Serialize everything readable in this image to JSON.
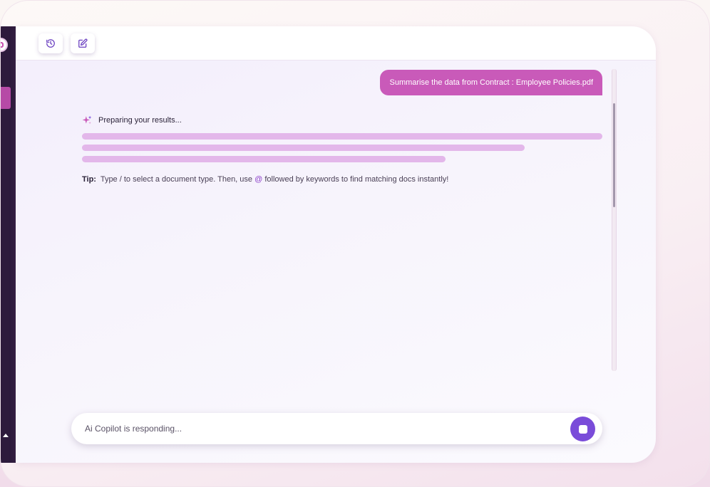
{
  "colors": {
    "accent": "#7a4cd9",
    "user_bubble": "#c95ab9",
    "sidebar": "#2d1a3c",
    "skeleton": "#e3b7ea"
  },
  "toolbar": {
    "history_icon": "history-icon",
    "new_chat_icon": "edit-icon"
  },
  "conversation": {
    "user_message": "Summarise the data from Contract : Employee Policies.pdf",
    "status_icon": "sparkle-icon",
    "status_text": "Preparing your results...",
    "tip": {
      "label": "Tip:",
      "text_before": "Type / to select a document type. Then, use",
      "at_symbol": "@",
      "text_after": "followed by keywords to find matching docs instantly!"
    }
  },
  "composer": {
    "placeholder": "Ai Copilot is responding...",
    "stop_icon": "stop-icon"
  }
}
